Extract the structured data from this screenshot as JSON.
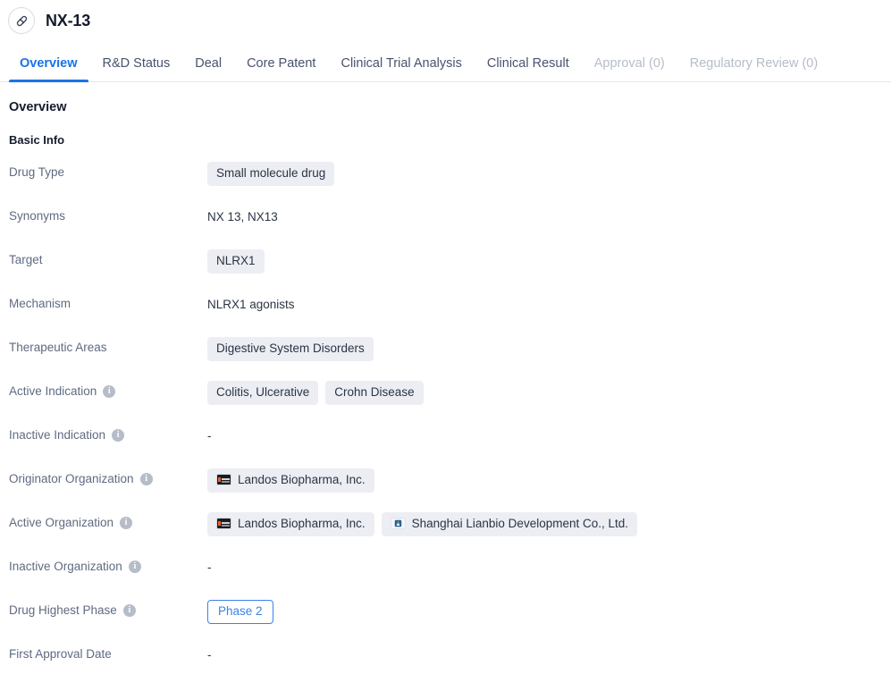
{
  "header": {
    "icon": "pill-capsule-icon",
    "title": "NX-13"
  },
  "tabs": [
    {
      "label": "Overview",
      "state": "active"
    },
    {
      "label": "R&D Status",
      "state": "normal"
    },
    {
      "label": "Deal",
      "state": "normal"
    },
    {
      "label": "Core Patent",
      "state": "normal"
    },
    {
      "label": "Clinical Trial Analysis",
      "state": "normal"
    },
    {
      "label": "Clinical Result",
      "state": "normal"
    },
    {
      "label": "Approval (0)",
      "state": "disabled"
    },
    {
      "label": "Regulatory Review (0)",
      "state": "disabled"
    }
  ],
  "content": {
    "section_title": "Overview",
    "subsection_title": "Basic Info",
    "rows": [
      {
        "label": "Drug Type",
        "has_info": false,
        "type": "chips",
        "values": [
          "Small molecule drug"
        ]
      },
      {
        "label": "Synonyms",
        "has_info": false,
        "type": "text",
        "values": [
          "NX 13,  NX13"
        ]
      },
      {
        "label": "Target",
        "has_info": false,
        "type": "chips",
        "values": [
          "NLRX1"
        ]
      },
      {
        "label": "Mechanism",
        "has_info": false,
        "type": "text",
        "values": [
          "NLRX1 agonists"
        ]
      },
      {
        "label": "Therapeutic Areas",
        "has_info": false,
        "type": "chips",
        "values": [
          "Digestive System Disorders"
        ]
      },
      {
        "label": "Active Indication",
        "has_info": true,
        "type": "chips",
        "values": [
          "Colitis, Ulcerative",
          "Crohn Disease"
        ]
      },
      {
        "label": "Inactive Indication",
        "has_info": true,
        "type": "dash",
        "values": [
          "-"
        ]
      },
      {
        "label": "Originator Organization",
        "has_info": true,
        "type": "orgs",
        "values": [
          {
            "name": "Landos Biopharma, Inc.",
            "logo": "landos"
          }
        ]
      },
      {
        "label": "Active Organization",
        "has_info": true,
        "type": "orgs",
        "values": [
          {
            "name": "Landos Biopharma, Inc.",
            "logo": "landos"
          },
          {
            "name": "Shanghai Lianbio Development Co., Ltd.",
            "logo": "lianbio"
          }
        ]
      },
      {
        "label": "Inactive Organization",
        "has_info": true,
        "type": "dash",
        "values": [
          "-"
        ]
      },
      {
        "label": "Drug Highest Phase",
        "has_info": true,
        "type": "phase",
        "values": [
          "Phase 2"
        ]
      },
      {
        "label": "First Approval Date",
        "has_info": false,
        "type": "dash",
        "values": [
          "-"
        ]
      }
    ]
  },
  "colors": {
    "accent": "#1a73e8",
    "phase_border": "#3b82e8",
    "chip_bg": "#eceef3",
    "label": "#5f6b80",
    "value": "#2b3445",
    "disabled_tab": "#b6bdc9"
  }
}
